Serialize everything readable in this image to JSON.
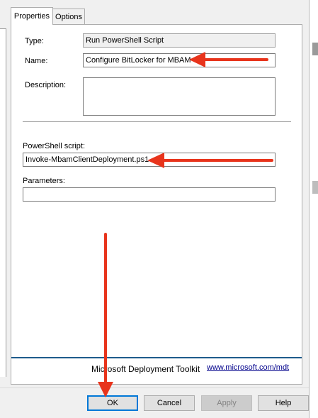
{
  "tabs": [
    "Properties",
    "Options"
  ],
  "fields": {
    "type": {
      "label": "Type:",
      "value": "Run PowerShell Script"
    },
    "name": {
      "label": "Name:",
      "value": "Configure BitLocker for MBAM"
    },
    "description": {
      "label": "Description:",
      "value": ""
    },
    "powershell_script": {
      "label": "PowerShell script:",
      "value": "Invoke-MbamClientDeployment.ps1"
    },
    "parameters": {
      "label": "Parameters:",
      "value": ""
    }
  },
  "branding": {
    "text": "Microsoft Deployment Toolkit",
    "link": "www.microsoft.com/mdt"
  },
  "buttons": {
    "ok": "OK",
    "cancel": "Cancel",
    "apply": "Apply",
    "help": "Help"
  },
  "colors": {
    "arrow": "#e8341c",
    "ok_focus": "#0078d7",
    "brand_line": "#1e5b8c"
  }
}
